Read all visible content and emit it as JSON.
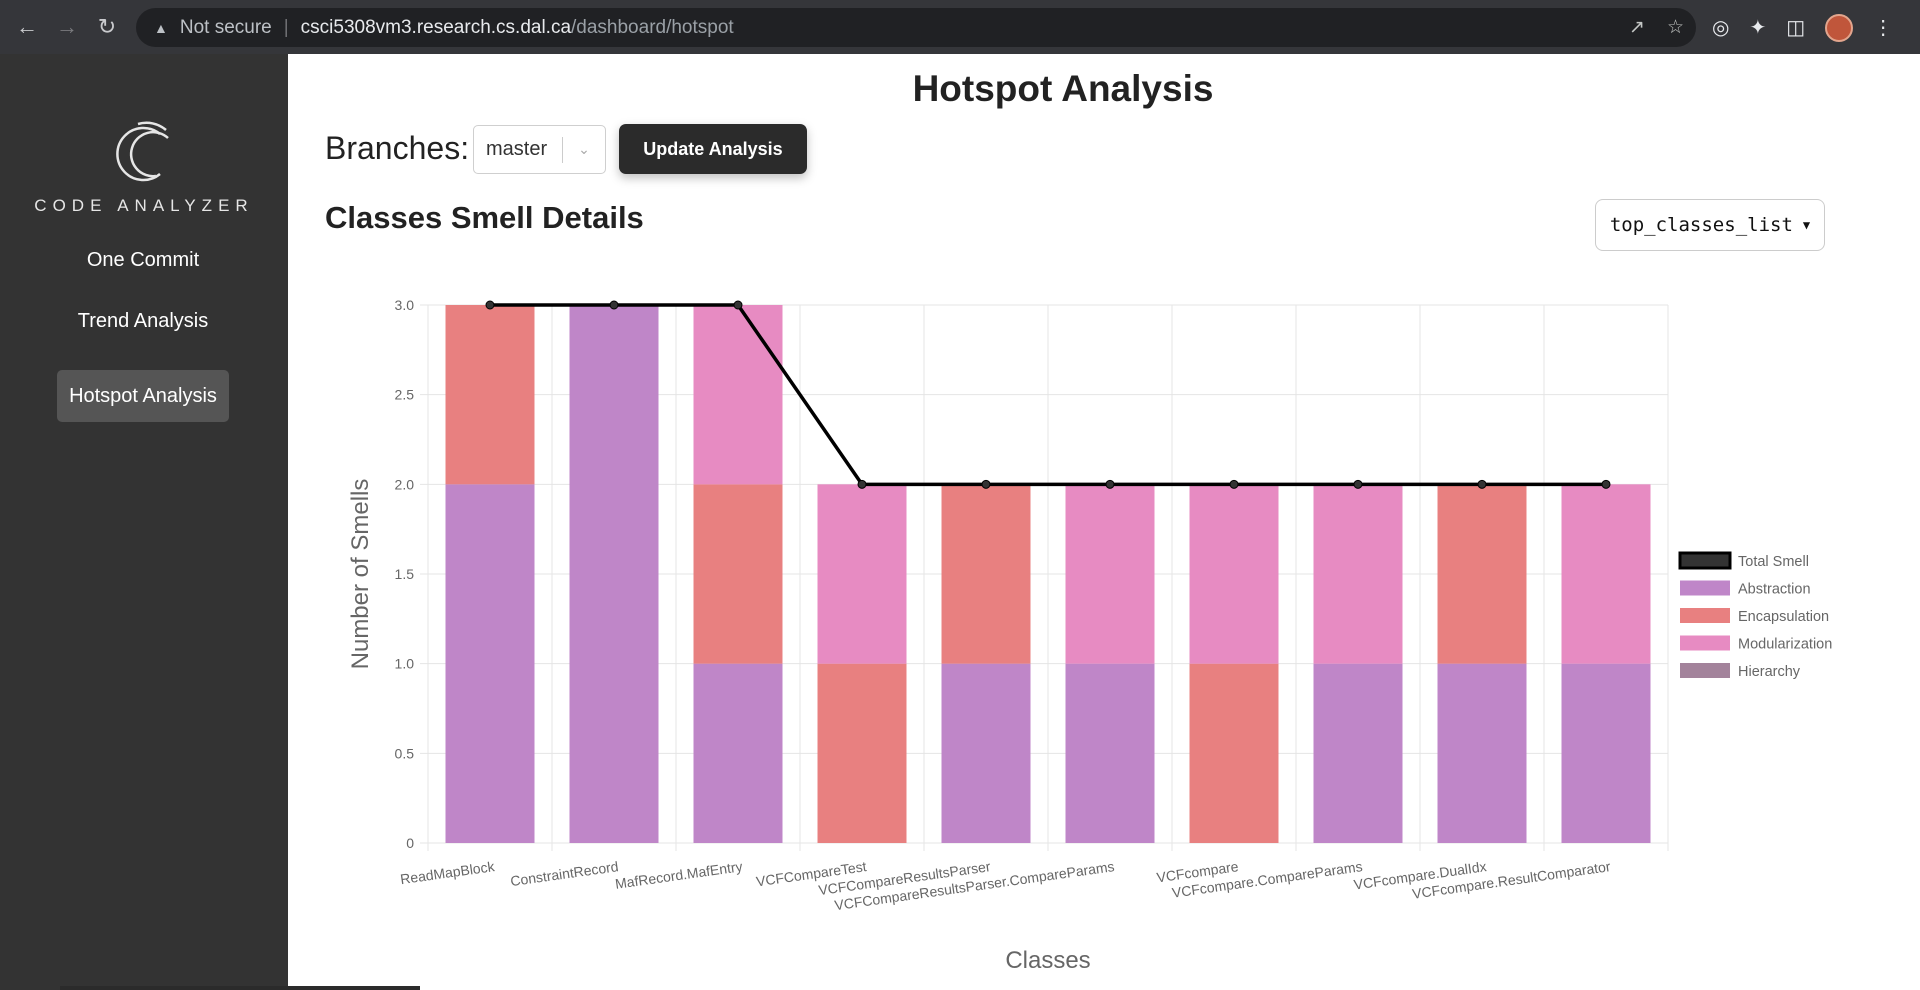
{
  "browser": {
    "security": "Not secure",
    "url_host": "csci5308vm3.research.cs.dal.ca",
    "url_path": "/dashboard/hotspot"
  },
  "sidebar": {
    "logo_text": "CODE ANALYZER",
    "items": [
      {
        "label": "One Commit",
        "active": false
      },
      {
        "label": "Trend Analysis",
        "active": false
      },
      {
        "label": "Hotspot Analysis",
        "active": true
      }
    ]
  },
  "main": {
    "title": "Hotspot Analysis",
    "branches_label": "Branches:",
    "branch_value": "master",
    "update_button": "Update Analysis",
    "section_title": "Classes Smell Details",
    "list_select_value": "top_classes_list"
  },
  "colors": {
    "abstraction": "#bf86c8",
    "encapsulation": "#e88080",
    "modularization": "#e78bc2",
    "hierarchy": "#a3839b",
    "total_line": "#000000"
  },
  "chart_data": {
    "type": "bar",
    "stacked": true,
    "categories": [
      "ReadMapBlock",
      "ConstraintRecord",
      "MafRecord.MafEntry",
      "VCFCompareTest",
      "VCFCompareResultsParser",
      "VCFCompareResultsParser.CompareParams",
      "VCFcompare",
      "VCFcompare.CompareParams",
      "VCFcompare.DualIdx",
      "VCFcompare.ResultComparator"
    ],
    "series": [
      {
        "name": "Total Smell",
        "type": "line",
        "values": [
          3,
          3,
          3,
          2,
          2,
          2,
          2,
          2,
          2,
          2
        ]
      },
      {
        "name": "Abstraction",
        "values": [
          2,
          3,
          1,
          0,
          1,
          1,
          0,
          1,
          1,
          1
        ]
      },
      {
        "name": "Encapsulation",
        "values": [
          1,
          0,
          1,
          1,
          1,
          0,
          1,
          0,
          1,
          0
        ]
      },
      {
        "name": "Modularization",
        "values": [
          0,
          0,
          1,
          1,
          0,
          1,
          1,
          1,
          0,
          1
        ]
      },
      {
        "name": "Hierarchy",
        "values": [
          0,
          0,
          0,
          0,
          0,
          0,
          0,
          0,
          0,
          0
        ]
      }
    ],
    "xlabel": "Classes",
    "ylabel": "Number of Smells",
    "ylim": [
      0,
      3
    ],
    "yticks": [
      "0",
      "0.5",
      "1.0",
      "1.5",
      "2.0",
      "2.5",
      "3.0"
    ],
    "grid": true,
    "legend_position": "right"
  }
}
